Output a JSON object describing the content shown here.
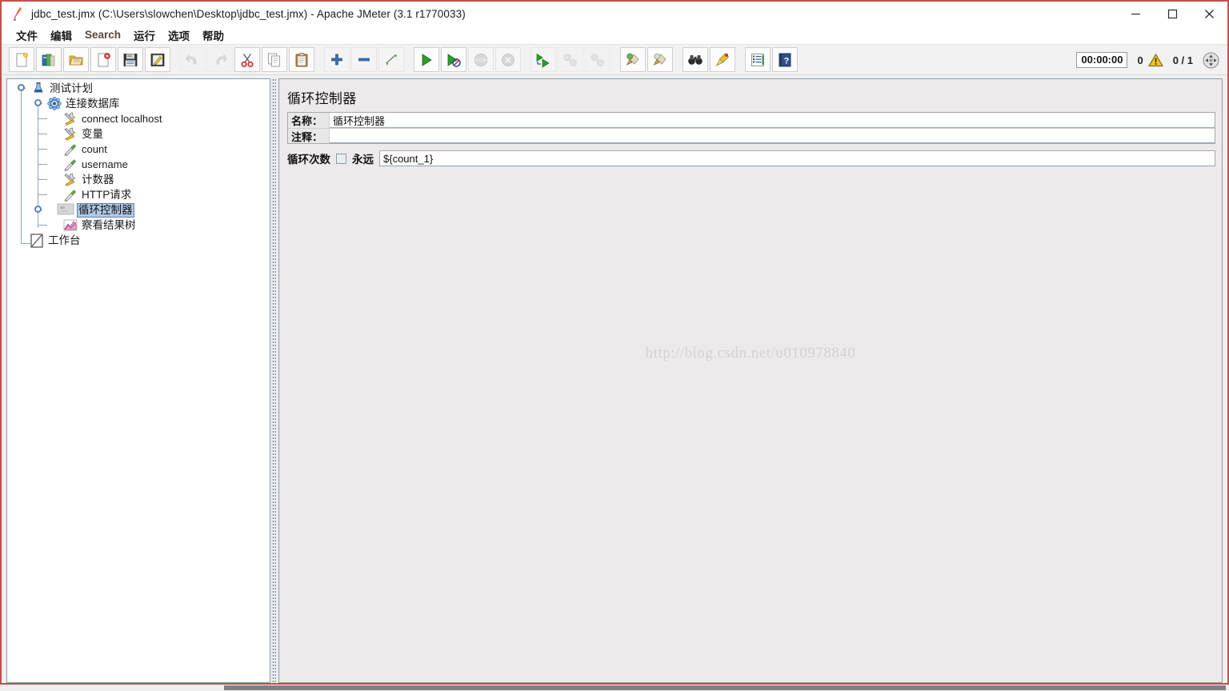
{
  "window": {
    "title": "jdbc_test.jmx (C:\\Users\\slowchen\\Desktop\\jdbc_test.jmx) - Apache JMeter (3.1 r1770033)",
    "app_icon": "jmeter-feather-icon",
    "border_color": "#c0504d",
    "controls": [
      {
        "name": "minimize-button",
        "glyph": "minimize"
      },
      {
        "name": "maximize-button",
        "glyph": "maximize"
      },
      {
        "name": "close-button",
        "glyph": "close"
      }
    ]
  },
  "menubar": {
    "items": [
      {
        "label": "文件",
        "name": "menu-file",
        "latin": false
      },
      {
        "label": "编辑",
        "name": "menu-edit",
        "latin": false
      },
      {
        "label": "Search",
        "name": "menu-search",
        "latin": true
      },
      {
        "label": "运行",
        "name": "menu-run",
        "latin": false
      },
      {
        "label": "选项",
        "name": "menu-options",
        "latin": false
      },
      {
        "label": "帮助",
        "name": "menu-help",
        "latin": false
      }
    ]
  },
  "toolbar": {
    "buttons": [
      {
        "name": "new-button",
        "icon": "new-document-icon",
        "enabled": true
      },
      {
        "name": "templates-button",
        "icon": "templates-icon",
        "enabled": true
      },
      {
        "name": "open-button",
        "icon": "open-folder-icon",
        "enabled": true
      },
      {
        "name": "close-button",
        "icon": "close-document-icon",
        "enabled": true
      },
      {
        "name": "save-button",
        "icon": "save-floppy-icon",
        "enabled": true
      },
      {
        "name": "save-as-button",
        "icon": "save-as-icon",
        "enabled": true
      },
      {
        "name": "undo-button",
        "icon": "undo-arrow-icon",
        "enabled": false
      },
      {
        "name": "redo-button",
        "icon": "redo-arrow-icon",
        "enabled": false
      },
      {
        "name": "cut-button",
        "icon": "scissors-icon",
        "enabled": true
      },
      {
        "name": "copy-button",
        "icon": "copy-pages-icon",
        "enabled": true
      },
      {
        "name": "paste-button",
        "icon": "clipboard-paste-icon",
        "enabled": true
      },
      {
        "name": "expand-button",
        "icon": "plus-icon",
        "enabled": true
      },
      {
        "name": "collapse-button",
        "icon": "minus-icon",
        "enabled": true
      },
      {
        "name": "toggle-button",
        "icon": "toggle-arrows-icon",
        "enabled": true
      },
      {
        "name": "start-button",
        "icon": "play-triangle-icon",
        "enabled": true
      },
      {
        "name": "start-no-pauses-button",
        "icon": "play-no-pause-icon",
        "enabled": true
      },
      {
        "name": "stop-button",
        "icon": "stop-sign-icon",
        "enabled": false
      },
      {
        "name": "shutdown-button",
        "icon": "shutdown-x-icon",
        "enabled": false
      },
      {
        "name": "remote-start-all-button",
        "icon": "remote-start-icon",
        "enabled": true
      },
      {
        "name": "remote-stop-all-button",
        "icon": "remote-stop-icon",
        "enabled": false
      },
      {
        "name": "remote-shutdown-all-button",
        "icon": "remote-shutdown-icon",
        "enabled": false
      },
      {
        "name": "clear-button",
        "icon": "broom-clear-icon",
        "enabled": true
      },
      {
        "name": "clear-all-button",
        "icon": "broom-clear-all-icon",
        "enabled": true
      },
      {
        "name": "search-button",
        "icon": "binoculars-icon",
        "enabled": true
      },
      {
        "name": "search-reset-button",
        "icon": "brush-reset-icon",
        "enabled": true
      },
      {
        "name": "function-helper-button",
        "icon": "function-list-icon",
        "enabled": true
      },
      {
        "name": "help-button",
        "icon": "help-book-icon",
        "enabled": true
      }
    ],
    "status": {
      "timer": "00:00:00",
      "warning_count": "0",
      "warning_icon": "warning-triangle-icon",
      "thread_count": "0 / 1",
      "expand_icon": "expand-collapse-icon"
    }
  },
  "tree": {
    "nodes": [
      {
        "label": "测试计划",
        "name": "tree-node-test-plan",
        "icon": "test-plan-icon",
        "depth": 0,
        "latin": false,
        "selected": false,
        "handle": true
      },
      {
        "label": "连接数据库",
        "name": "tree-node-thread-group",
        "icon": "thread-group-icon",
        "depth": 1,
        "latin": false,
        "selected": false,
        "handle": true
      },
      {
        "label": "connect localhost",
        "name": "tree-node-connect-localhost",
        "icon": "config-element-icon",
        "depth": 2,
        "latin": true,
        "selected": false,
        "handle": false
      },
      {
        "label": "变量",
        "name": "tree-node-variables",
        "icon": "config-element-icon",
        "depth": 2,
        "latin": false,
        "selected": false,
        "handle": false
      },
      {
        "label": "count",
        "name": "tree-node-count",
        "icon": "sampler-icon",
        "depth": 2,
        "latin": true,
        "selected": false,
        "handle": false
      },
      {
        "label": "username",
        "name": "tree-node-username",
        "icon": "sampler-icon",
        "depth": 2,
        "latin": true,
        "selected": false,
        "handle": false
      },
      {
        "label": "计数器",
        "name": "tree-node-counter",
        "icon": "config-element-icon",
        "depth": 2,
        "latin": false,
        "selected": false,
        "handle": false
      },
      {
        "label": "HTTP请求",
        "name": "tree-node-http-request",
        "icon": "sampler-icon",
        "depth": 2,
        "latin": false,
        "selected": false,
        "handle": false
      },
      {
        "label": "循环控制器",
        "name": "tree-node-loop-controller",
        "icon": "loop-controller-icon",
        "depth": 2,
        "latin": false,
        "selected": true,
        "handle": true
      },
      {
        "label": "察看结果树",
        "name": "tree-node-view-results-tree",
        "icon": "view-results-tree-icon",
        "depth": 2,
        "latin": false,
        "selected": false,
        "handle": false
      },
      {
        "label": "工作台",
        "name": "tree-node-workbench",
        "icon": "workbench-icon",
        "depth": 0,
        "latin": false,
        "selected": false,
        "handle": false
      }
    ]
  },
  "right_panel": {
    "title": "循环控制器",
    "name_label": "名称：",
    "name_value": "循环控制器",
    "comment_label": "注释：",
    "comment_value": "",
    "loop_label": "循环次数",
    "forever_label": "永远",
    "forever_checked": false,
    "loop_count_value": "${count_1}",
    "watermark": "http://blog.csdn.net/u010978840"
  }
}
